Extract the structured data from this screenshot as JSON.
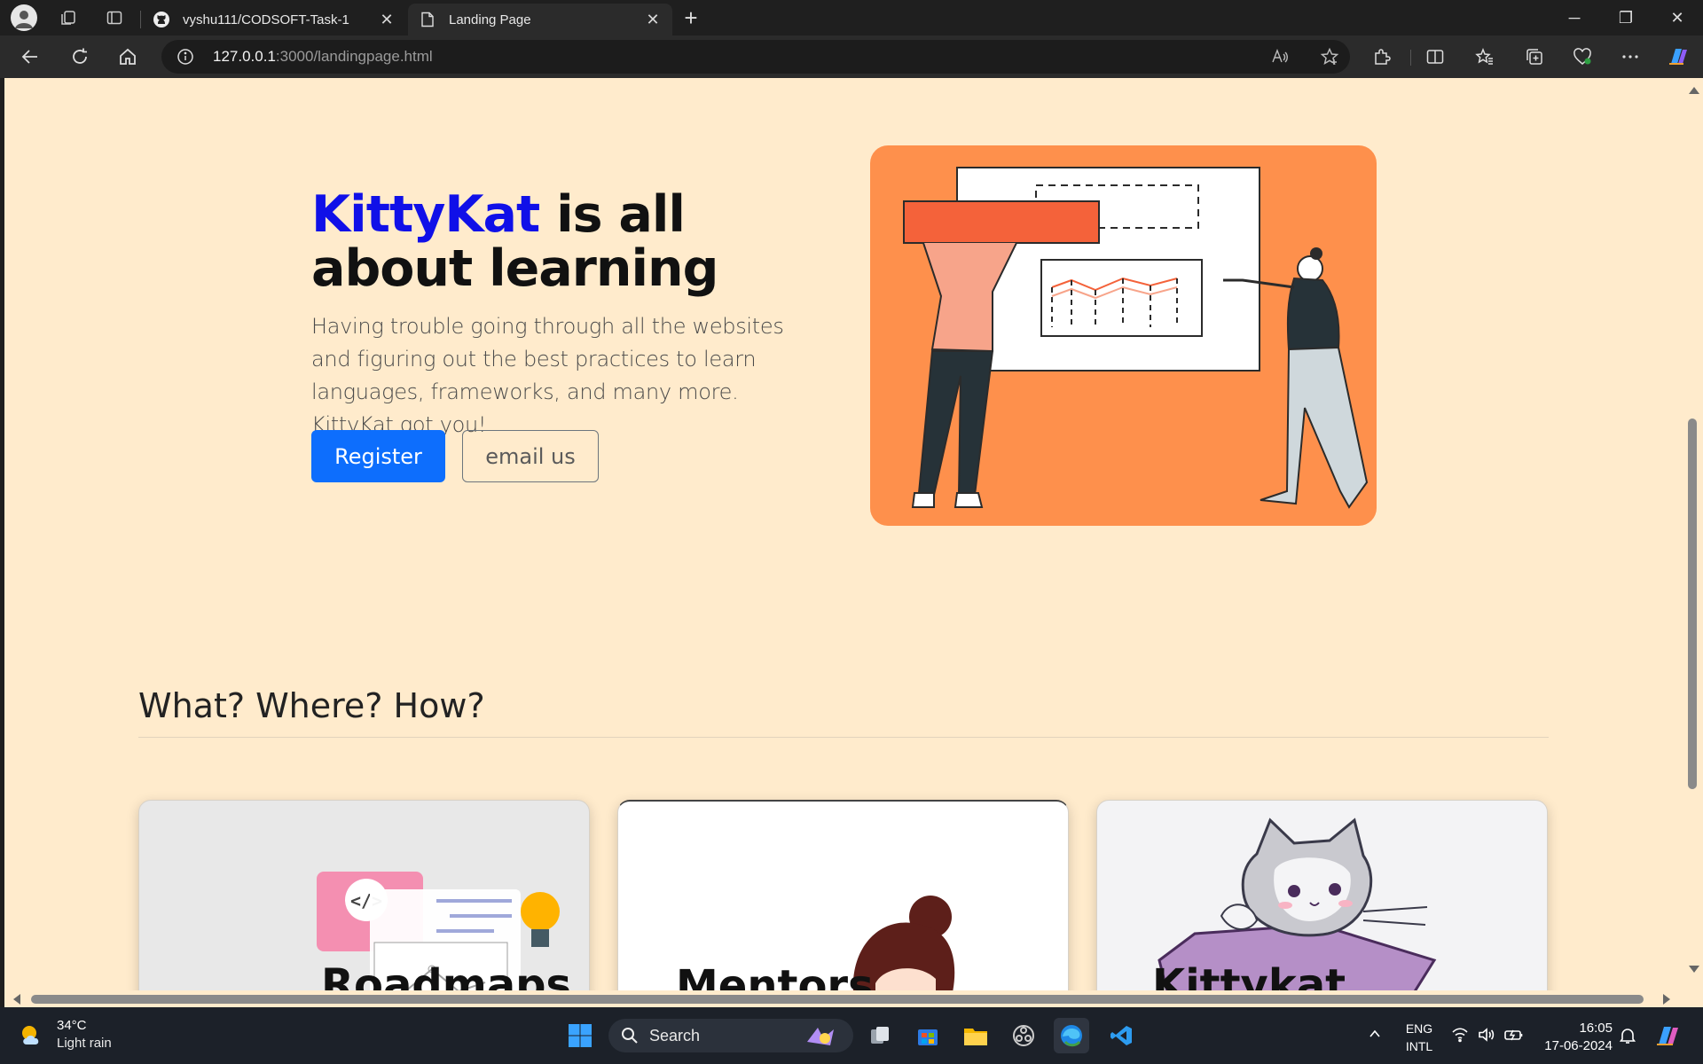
{
  "browser": {
    "tabs": [
      {
        "title": "vyshu111/CODSOFT-Task-1",
        "icon": "github-icon",
        "active": false
      },
      {
        "title": "Landing Page",
        "icon": "page-icon",
        "active": true
      }
    ],
    "url": {
      "host": "127.0.0.1",
      "path": ":3000/landingpage.html"
    }
  },
  "hero": {
    "brand": "KittyKat",
    "title_rest": " is all about learning",
    "text": "Having trouble going through all the websites and figuring out the best practices to learn languages, frameworks, and many more. KittyKat got you!",
    "primary_button": "Register",
    "secondary_button": "email us"
  },
  "section": {
    "title": "What? Where? How?",
    "cards": [
      {
        "title": "Roadmaps"
      },
      {
        "title": "Mentors"
      },
      {
        "title": "Kittykat"
      }
    ]
  },
  "taskbar": {
    "weather": {
      "temp": "34°C",
      "condition": "Light rain"
    },
    "search_label": "Search",
    "lang": {
      "line1": "ENG",
      "line2": "INTL"
    },
    "time": "16:05",
    "date": "17-06-2024"
  },
  "colors": {
    "page_bg": "#ffebcc",
    "brand_blue": "#1010e8",
    "primary": "#0d6efd",
    "hero_image_bg": "#fe904c"
  }
}
